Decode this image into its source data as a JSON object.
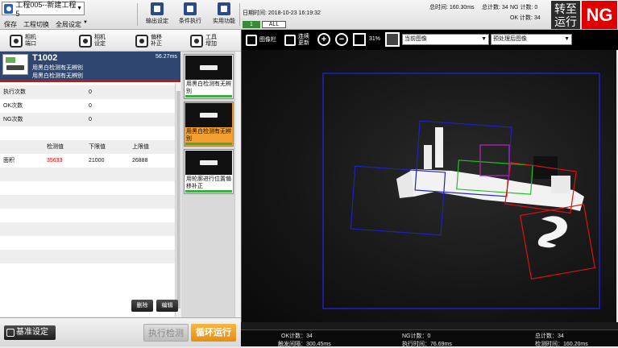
{
  "top": {
    "project": "工程005--新建工程5",
    "menus": [
      "保存",
      "工程切换",
      "全局设定"
    ],
    "tools": [
      {
        "label": "输出设定",
        "icon": "output-settings-icon"
      },
      {
        "label": "条件执行",
        "icon": "conditional-exec-icon"
      },
      {
        "label": "实用功能",
        "icon": "utility-icon"
      }
    ],
    "badges": {
      "one": "1",
      "all": "ALL"
    },
    "datetime": "日期时间: 2018-10-23 16:19:32",
    "total_time": "总时间: 160.30ms",
    "total_count": "总计数: 34",
    "ng_count": "NG 计数: 0",
    "ok_count": "OK 计数: 34",
    "switch_run": "转至运行",
    "result": "NG"
  },
  "left_toolbar": [
    {
      "label": "相机\n端口",
      "icon": "camera-port-icon"
    },
    {
      "label": "相机\n设定",
      "icon": "camera-settings-icon"
    },
    {
      "label": "偏移\n补正",
      "icon": "offset-correction-icon"
    },
    {
      "label": "工具\n增加",
      "icon": "add-tool-icon"
    }
  ],
  "tool": {
    "id": "T1002",
    "time": "56.27ms",
    "name1": "用黑白检测有无辨别",
    "name2": "用黑白检测有无辨别"
  },
  "stats": {
    "exec_label": "执行次数",
    "exec_val": "0",
    "ok_label": "OK次数",
    "ok_val": "0",
    "ng_label": "NG次数",
    "ng_val": "0"
  },
  "measure": {
    "h_detect": "检测值",
    "h_lower": "下限值",
    "h_upper": "上限值",
    "row_label": "面积",
    "detect": "35633",
    "lower": "21000",
    "upper": "26888"
  },
  "buttons": {
    "delete": "删除",
    "edit": "编辑"
  },
  "flow": [
    {
      "label": "用黑白检测有无辨别"
    },
    {
      "label": "用黑白检测有无辨别"
    },
    {
      "label": "用轮廓进行位置偏移补正"
    }
  ],
  "bottom": {
    "base": "基准设定",
    "exec": "执行检测",
    "loop": "循环运行"
  },
  "img_toolbar": {
    "image_bar": "图像栏",
    "continuous_update": "连续\n更新",
    "zoom": "31%",
    "current_image": "当前图像",
    "preprocessed": "预处理后图像"
  },
  "status": {
    "ok": "OK计数：34",
    "ng": "NG计数：0",
    "total": "总计数：34",
    "trigger": "触发间隔：300.45ms",
    "exec": "执行时间：76.69ms",
    "detect": "检测时间：160.20ms"
  },
  "colors": {
    "ng": "#e00000",
    "accent": "#f3a030",
    "header": "#2e4670"
  }
}
